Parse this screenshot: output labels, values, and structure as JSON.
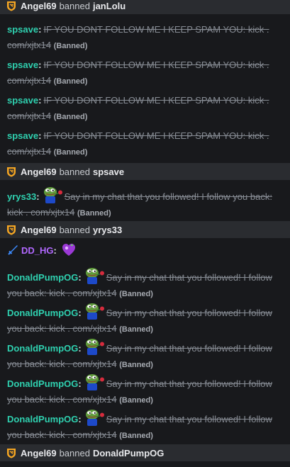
{
  "colors": {
    "background": "#18191c",
    "ban_row_bg": "#2a2c30",
    "username_teal": "#2fd1b0",
    "username_purple": "#b168ff",
    "shield_orange": "#f5a623",
    "deleted_text": "#878c94"
  },
  "icons": {
    "shield": "moderator-shield-icon",
    "sword": "sword-badge-icon",
    "frog": "pepe-frog-rose-emote",
    "heart": "purple-heart-emote"
  },
  "bans": [
    {
      "moderator": "Angel69",
      "verb": "banned",
      "target": "janLolu"
    },
    {
      "moderator": "Angel69",
      "verb": "banned",
      "target": "spsave"
    },
    {
      "moderator": "Angel69",
      "verb": "banned",
      "target": "yrys33"
    },
    {
      "moderator": "Angel69",
      "verb": "banned",
      "target": "DonaldPumpOG"
    }
  ],
  "messages": [
    {
      "user": "spsave",
      "text": "IF YOU DONT FOLLOW ME I KEEP SPAM YOU: kick . com/xjtx14",
      "tag": "(Banned)"
    },
    {
      "user": "spsave",
      "text": "IF YOU DONT FOLLOW ME I KEEP SPAM YOU: kick . com/xjtx14",
      "tag": "(Banned)"
    },
    {
      "user": "spsave",
      "text": "IF YOU DONT FOLLOW ME I KEEP SPAM YOU: kick . com/xjtx14",
      "tag": "(Banned)"
    },
    {
      "user": "spsave",
      "text": "IF YOU DONT FOLLOW ME I KEEP SPAM YOU: kick . com/xjtx14",
      "tag": "(Banned)"
    },
    {
      "user": "yrys33",
      "text": "Say in my chat that you followed! I follow you back: kick . com/xjtx14",
      "tag": "(Banned)"
    },
    {
      "user": "DD_HG",
      "text": ""
    },
    {
      "user": "DonaldPumpOG",
      "text": "Say in my chat that you followed! I follow you back: kick . com/xjtx14",
      "tag": "(Banned)"
    },
    {
      "user": "DonaldPumpOG",
      "text": "Say in my chat that you followed! I follow you back: kick . com/xjtx14",
      "tag": "(Banned)"
    },
    {
      "user": "DonaldPumpOG",
      "text": "Say in my chat that you followed! I follow you back: kick . com/xjtx14",
      "tag": "(Banned)"
    },
    {
      "user": "DonaldPumpOG",
      "text": "Say in my chat that you followed! I follow you back: kick . com/xjtx14",
      "tag": "(Banned)"
    },
    {
      "user": "DonaldPumpOG",
      "text": "Say in my chat that you followed! I follow you back: kick . com/xjtx14",
      "tag": "(Banned)"
    }
  ]
}
